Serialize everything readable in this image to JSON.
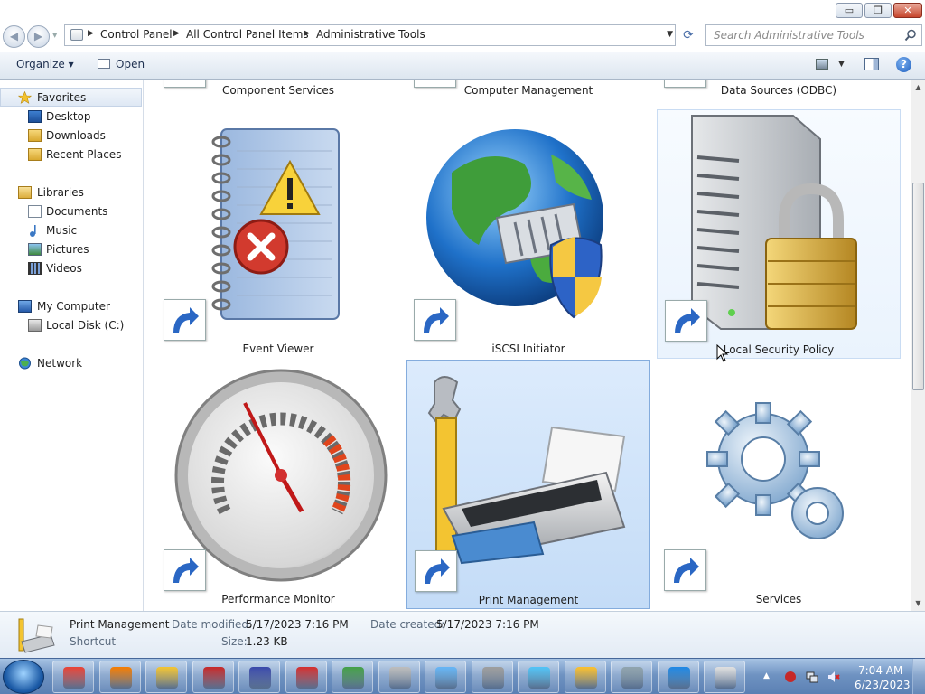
{
  "window": {
    "min_glyph": "▭",
    "max_glyph": "❐",
    "close_glyph": "✕"
  },
  "address": {
    "crumbs": [
      "Control Panel",
      "All Control Panel Items",
      "Administrative Tools"
    ],
    "search_placeholder": "Search Administrative Tools"
  },
  "toolbar": {
    "organize_label": "Organize ▾",
    "open_label": "Open",
    "help_glyph": "?"
  },
  "nav": {
    "favorites": "Favorites",
    "desktop": "Desktop",
    "downloads": "Downloads",
    "recent_places": "Recent Places",
    "libraries": "Libraries",
    "documents": "Documents",
    "music": "Music",
    "pictures": "Pictures",
    "videos": "Videos",
    "my_computer": "My Computer",
    "local_disk": "Local Disk (C:)",
    "network": "Network"
  },
  "items": {
    "component_services": "Component Services",
    "computer_management": "Computer Management",
    "data_sources": "Data Sources (ODBC)",
    "event_viewer": "Event Viewer",
    "iscsi_initiator": "iSCSI Initiator",
    "local_security_policy": "Local Security Policy",
    "performance_monitor": "Performance Monitor",
    "print_management": "Print Management",
    "services": "Services"
  },
  "details": {
    "name": "Print Management",
    "type": "Shortcut",
    "modified_label": "Date modified:",
    "modified_value": "5/17/2023 7:16 PM",
    "created_label": "Date created:",
    "created_value": "5/17/2023 7:16 PM",
    "size_label": "Size:",
    "size_value": "1.23 KB"
  },
  "taskbar": {
    "time": "7:04 AM",
    "date": "6/23/2023",
    "apps": [
      "chrome-icon",
      "firefox-icon",
      "explorer-icon",
      "app-red-icon",
      "app-blue-icon",
      "recorder-icon",
      "app-green-icon",
      "printer-icon",
      "mail-icon",
      "calculator-icon",
      "control-panel-icon",
      "app-yellow-icon",
      "computer-icon",
      "network-shield-icon",
      "battery-icon"
    ]
  },
  "colors": {
    "selection_bg": "#c4dcf7",
    "selection_border": "#84acdd",
    "taskbar": "#5b80b3"
  }
}
